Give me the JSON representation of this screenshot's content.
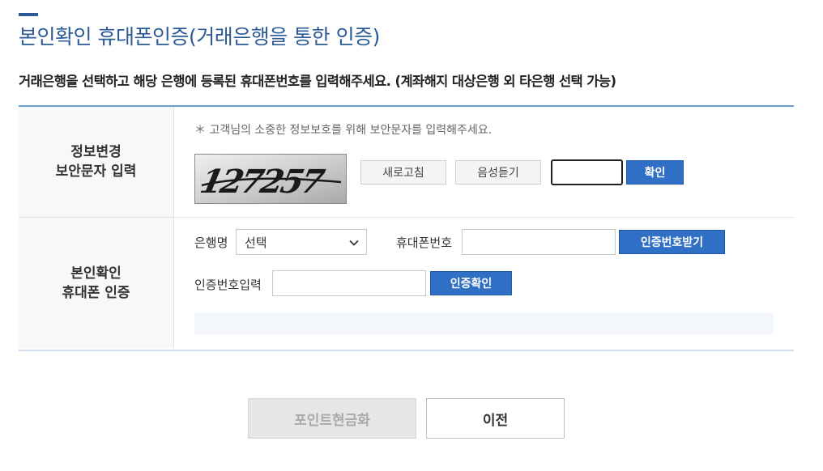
{
  "page": {
    "title": "본인확인 휴대폰인증(거래은행을 통한 인증)",
    "description": "거래은행을 선택하고 해당 은행에 등록된 휴대폰번호를 입력해주세요. (계좌해지 대상은행 외 타은행 선택 가능)"
  },
  "captcha_section": {
    "label_line1": "정보변경",
    "label_line2": "보안문자 입력",
    "note": "＊ 고객님의 소중한 정보보호를 위해 보안문자를 입력해주세요.",
    "captcha_text": "127257",
    "refresh_label": "새로고침",
    "audio_label": "음성듣기",
    "input_value": "",
    "confirm_label": "확인"
  },
  "phone_section": {
    "label_line1": "본인확인",
    "label_line2": "휴대폰 인증",
    "bank_label": "은행명",
    "bank_selected": "선택",
    "phone_label": "휴대폰번호",
    "phone_value": "",
    "request_code_label": "인증번호받기",
    "code_label": "인증번호입력",
    "code_value": "",
    "verify_label": "인증확인"
  },
  "footer": {
    "cash_points_label": "포인트현금화",
    "prev_label": "이전"
  },
  "colors": {
    "accent": "#2b5a97",
    "button_blue": "#2f6fc5"
  }
}
